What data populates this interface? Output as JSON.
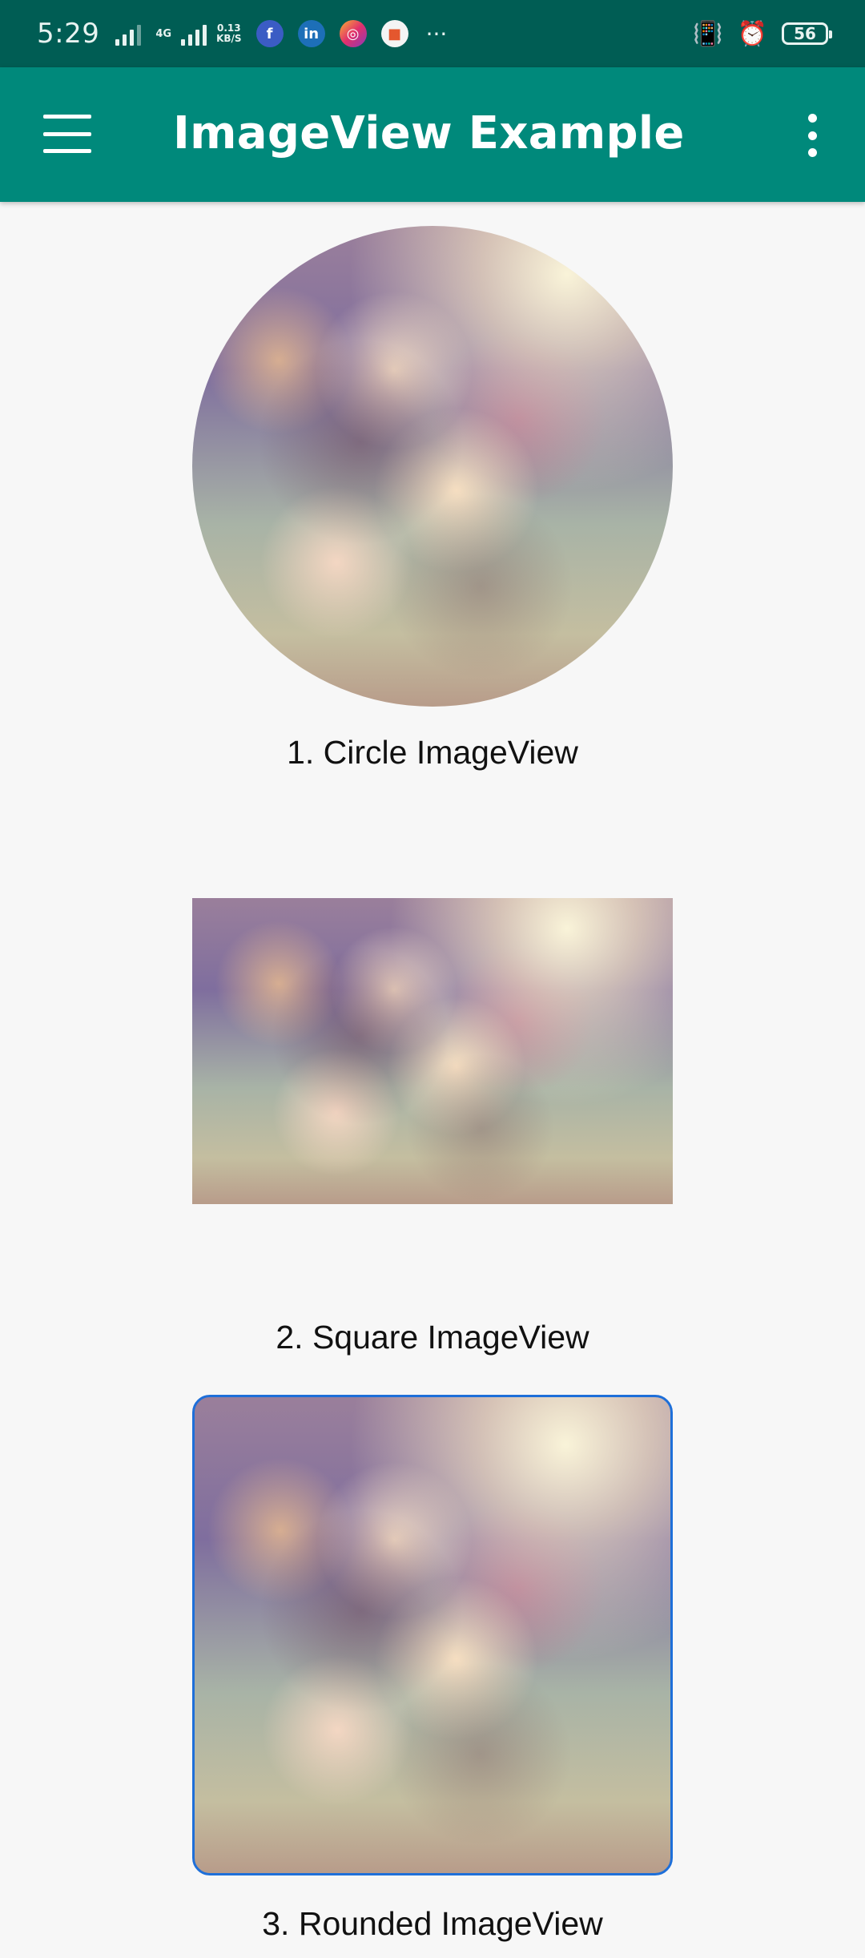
{
  "status_bar": {
    "time": "5:29",
    "network_type": "4G",
    "data_speed_value": "0.13",
    "data_speed_unit": "KB/S",
    "battery_level": "56",
    "app_icons": [
      "facebook-icon",
      "linkedin-icon",
      "instagram-icon",
      "app-icon"
    ],
    "more_indicator": "···"
  },
  "app_bar": {
    "title": "ImageView Example",
    "background_color": "#00897B",
    "status_bar_color": "#005D54"
  },
  "content": {
    "images": [
      {
        "shape": "circle",
        "caption": "1. Circle ImageView"
      },
      {
        "shape": "square",
        "caption": "2. Square ImageView"
      },
      {
        "shape": "rounded",
        "caption": "3. Rounded ImageView",
        "border_color": "#1E6FD9"
      }
    ],
    "background_color": "#F7F7F7"
  }
}
